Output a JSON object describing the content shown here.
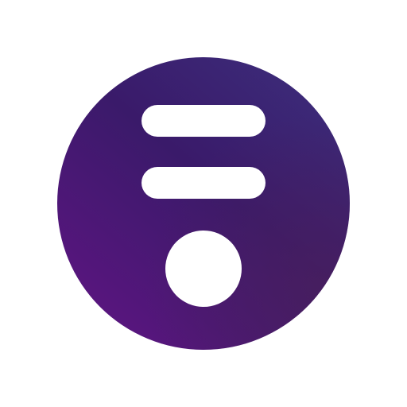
{
  "logo": {
    "icon": "purple-circle-app-logo",
    "colors": {
      "background": "#ffffff",
      "gradient_top_right": "#3c2c7a",
      "gradient_mid": "#3a1a6a",
      "gradient_bottom_left": "#5b1580",
      "gradient_bottom_right": "#4a1f5c",
      "glyph": "#ffffff"
    }
  }
}
